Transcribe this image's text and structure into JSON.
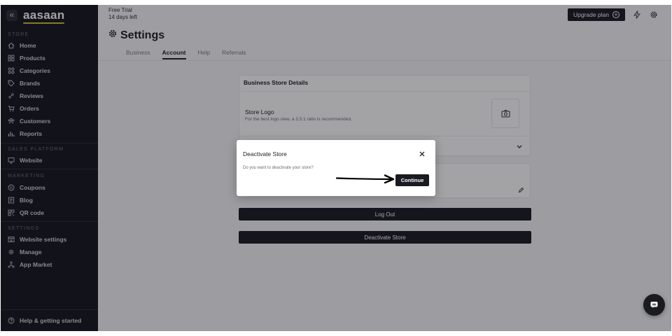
{
  "brand": {
    "name": "aasaan",
    "collapse_glyph": "«"
  },
  "sidebar": {
    "sections": [
      {
        "label": "STORE"
      },
      {
        "label": "SALES PLATFORM"
      },
      {
        "label": "MARKETING"
      },
      {
        "label": "SETTINGS"
      }
    ],
    "items": [
      {
        "label": "Home",
        "icon": "home-icon"
      },
      {
        "label": "Products",
        "icon": "grid-icon"
      },
      {
        "label": "Categories",
        "icon": "categories-icon"
      },
      {
        "label": "Brands",
        "icon": "tag-icon"
      },
      {
        "label": "Reviews",
        "icon": "link-icon"
      },
      {
        "label": "Orders",
        "icon": "cart-icon"
      },
      {
        "label": "Customers",
        "icon": "users-icon"
      },
      {
        "label": "Reports",
        "icon": "bar-chart-icon"
      },
      {
        "label": "Website",
        "icon": "monitor-icon"
      },
      {
        "label": "Coupons",
        "icon": "coupon-icon"
      },
      {
        "label": "Blog",
        "icon": "blog-icon"
      },
      {
        "label": "QR code",
        "icon": "qr-code-icon"
      },
      {
        "label": "Website settings",
        "icon": "website-settings-icon"
      },
      {
        "label": "Manage",
        "icon": "gear-icon"
      },
      {
        "label": "App Market",
        "icon": "app-market-icon"
      }
    ],
    "help": {
      "label": "Help & getting started",
      "icon": "help-icon"
    }
  },
  "header": {
    "trial_label": "Free Trial",
    "trial_days": "14 days left",
    "title": "Settings",
    "tabs": [
      {
        "label": "Business",
        "active": false
      },
      {
        "label": "Account",
        "active": true
      },
      {
        "label": "Help",
        "active": false
      },
      {
        "label": "Referrals",
        "active": false
      }
    ],
    "upgrade_label": "Upgrade plan",
    "icons": [
      "lightning-icon",
      "gear-icon"
    ]
  },
  "main": {
    "card_title": "Business Store Details",
    "store_logo_label": "Store Logo",
    "store_logo_hint": "For the best logo view, a 3.5:1 ratio is recommended.",
    "logout_label": "Log Out",
    "deactivate_label": "Deactivate Store"
  },
  "modal": {
    "title": "Deactivate Store",
    "message": "Do you want to deactivate your store?",
    "continue_label": "Continue"
  },
  "colors": {
    "sidebar_bg": "#15161d",
    "accent": "#d7c21a",
    "button_dark": "#1a1b22",
    "overlay": "rgba(12,12,20,0.38)"
  }
}
